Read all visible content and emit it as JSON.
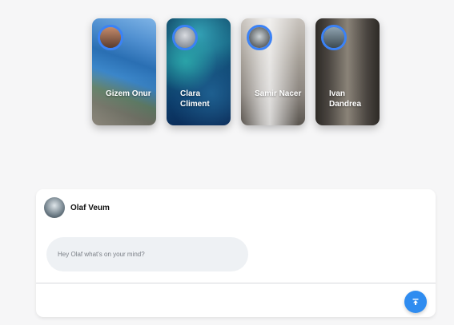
{
  "stories": [
    {
      "name": "Gizem Onur",
      "avatar_icon": "person-avatar"
    },
    {
      "name": "Clara Climent",
      "avatar_icon": "person-avatar"
    },
    {
      "name": "Samir Nacer",
      "avatar_icon": "person-avatar"
    },
    {
      "name": "Ivan Dandrea",
      "avatar_icon": "person-avatar"
    }
  ],
  "composer": {
    "user_name": "Olaf Veum",
    "input_placeholder": "Hey Olaf what's on your mind?",
    "input_value": "",
    "submit_icon": "upload-arrow-icon"
  },
  "colors": {
    "accent": "#2f8cf0",
    "story_ring": "#3b82f6",
    "input_bg": "#eef1f4",
    "page_bg": "#f6f6f7"
  }
}
